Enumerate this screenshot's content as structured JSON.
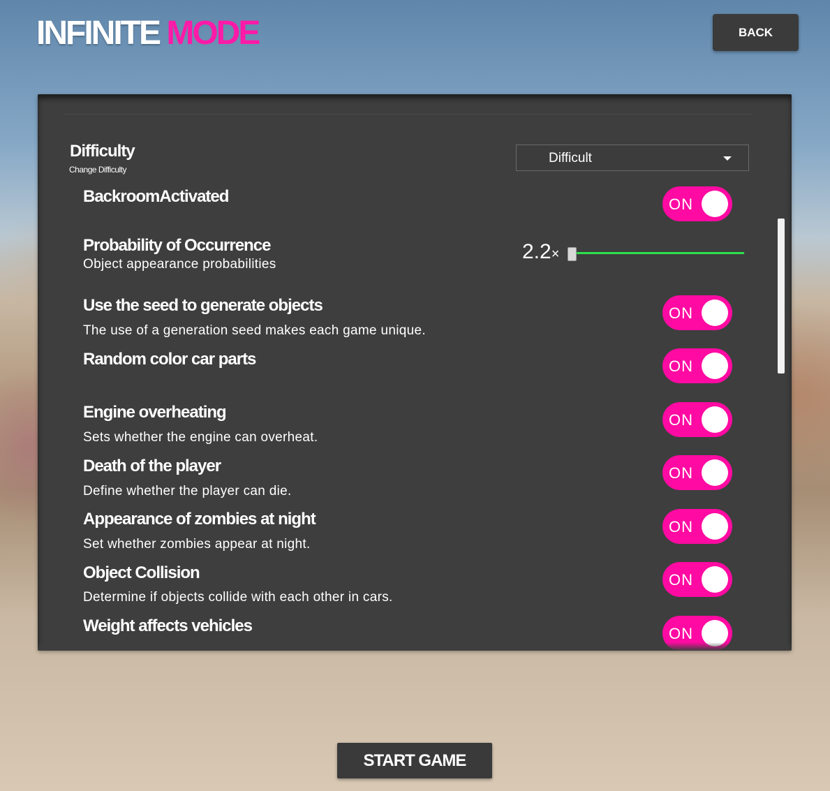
{
  "header": {
    "title_white": "INFINITE",
    "title_pink": "MODE",
    "back_label": "BACK"
  },
  "difficulty": {
    "label": "Difficulty",
    "sublabel": "Change Difficulty",
    "selected": "Difficult"
  },
  "options": [
    {
      "title": "BackroomActivated",
      "desc": "",
      "state": "ON"
    },
    {
      "title": "Probability of Occurrence",
      "desc": "Object appearance probabilities",
      "value": "2.2",
      "unit": "×"
    },
    {
      "title": "Use the seed to generate objects",
      "desc": "The use of a generation seed makes each game unique.",
      "state": "ON"
    },
    {
      "title": "Random color car parts",
      "desc": "",
      "state": "ON"
    },
    {
      "title": "Engine overheating",
      "desc": "Sets whether the engine can overheat.",
      "state": "ON"
    },
    {
      "title": "Death of the player",
      "desc": "Define whether the player can die.",
      "state": "ON"
    },
    {
      "title": "Appearance of zombies at night",
      "desc": "Set whether zombies appear at night.",
      "state": "ON"
    },
    {
      "title": "Object Collision",
      "desc": "Determine if objects collide with each other in cars.",
      "state": "ON"
    },
    {
      "title": "Weight affects vehicles",
      "desc": "",
      "state": "ON"
    }
  ],
  "slider": {
    "fraction": 0.0
  },
  "colors": {
    "accent": "#ff0aa2",
    "slider": "#2ee04c",
    "panel": "#3e3e3e"
  },
  "footer": {
    "start_label": "START GAME"
  }
}
